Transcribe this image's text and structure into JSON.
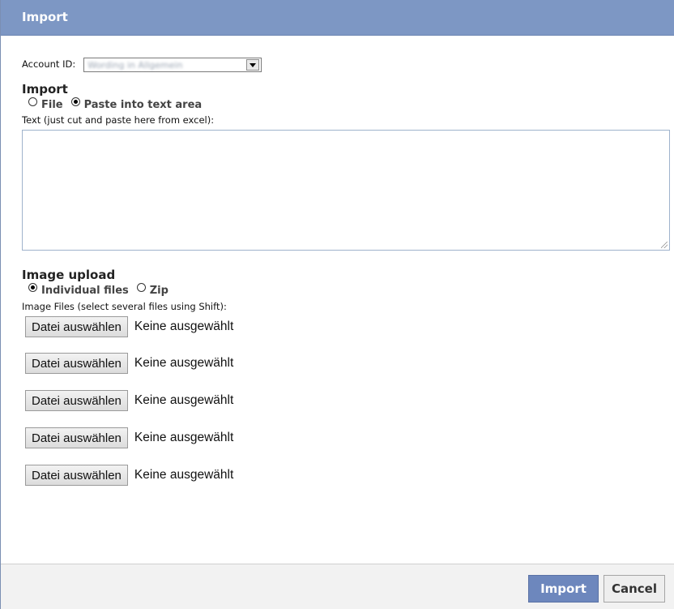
{
  "dialog": {
    "title": "Import"
  },
  "account": {
    "label": "Account ID:",
    "selected_value": "Wording in Allgemein"
  },
  "import_section": {
    "title": "Import",
    "options": [
      {
        "label": "File",
        "checked": false
      },
      {
        "label": "Paste into text area",
        "checked": true
      }
    ],
    "text_label": "Text (just cut and paste here from excel):",
    "text_value": ""
  },
  "image_section": {
    "title": "Image upload",
    "options": [
      {
        "label": "Individual files",
        "checked": true
      },
      {
        "label": "Zip",
        "checked": false
      }
    ],
    "files_label": "Image Files (select several files using Shift):",
    "file_inputs": [
      {
        "button": "Datei auswählen",
        "status": "Keine ausgewählt"
      },
      {
        "button": "Datei auswählen",
        "status": "Keine ausgewählt"
      },
      {
        "button": "Datei auswählen",
        "status": "Keine ausgewählt"
      },
      {
        "button": "Datei auswählen",
        "status": "Keine ausgewählt"
      },
      {
        "button": "Datei auswählen",
        "status": "Keine ausgewählt"
      }
    ]
  },
  "footer": {
    "import_label": "Import",
    "cancel_label": "Cancel"
  },
  "colors": {
    "title_bar": "#7d97c4",
    "primary_button": "#6d87bd",
    "footer_bg": "#f2f2f2"
  }
}
